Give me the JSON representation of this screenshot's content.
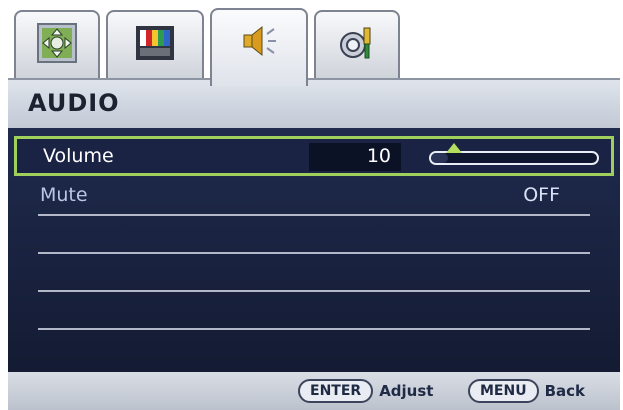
{
  "tabs": [
    {
      "icon": "display-position-icon",
      "active": false
    },
    {
      "icon": "picture-color-icon",
      "active": false
    },
    {
      "icon": "speaker-icon",
      "active": true
    },
    {
      "icon": "system-settings-icon",
      "active": false
    }
  ],
  "header": {
    "title": "AUDIO"
  },
  "menu": {
    "items": [
      {
        "label": "Volume",
        "value": "10",
        "level": 0.1,
        "selected": true
      },
      {
        "label": "Mute",
        "value": "OFF",
        "selected": false
      }
    ]
  },
  "footer": {
    "enter_key": "ENTER",
    "enter_action": "Adjust",
    "menu_key": "MENU",
    "menu_action": "Back"
  },
  "colors": {
    "panel": "#1f2a4d",
    "selection_border": "#9fd05b",
    "accent_thumb": "#b4de5e",
    "header": "#d3d9e3"
  }
}
